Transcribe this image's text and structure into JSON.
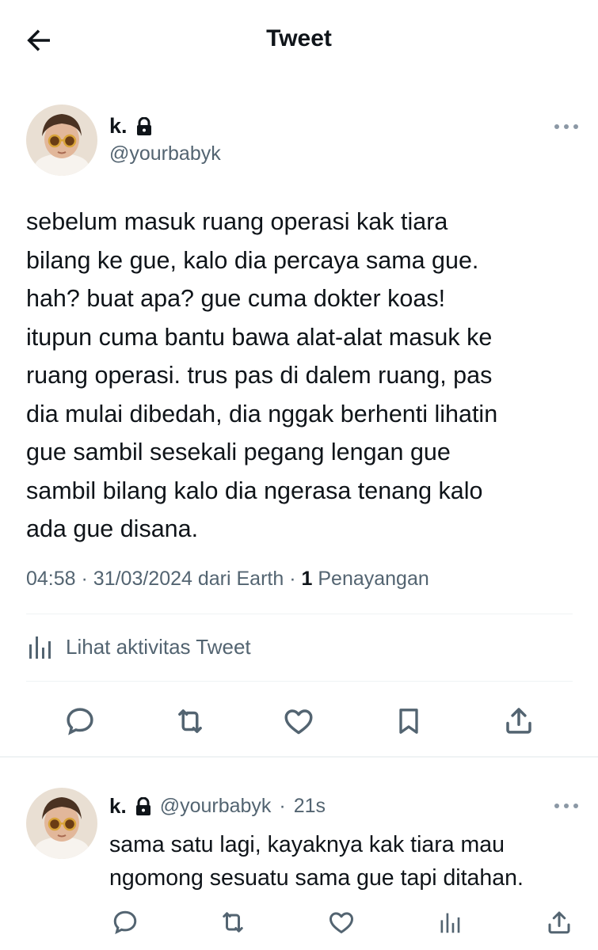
{
  "header": {
    "title": "Tweet"
  },
  "tweet": {
    "name": "k.",
    "handle": "@yourbabyk",
    "text": "sebelum masuk ruang operasi kak tiara\nbilang ke gue, kalo dia percaya sama gue.\nhah? buat apa? gue cuma dokter koas!\nitupun cuma bantu bawa alat-alat masuk ke\nruang operasi. trus pas di dalem ruang, pas\ndia mulai dibedah, dia nggak berhenti lihatin\ngue sambil sesekali pegang lengan gue\nsambil bilang kalo dia ngerasa tenang kalo\nada gue disana.",
    "time": "04:58",
    "date": "31/03/2024",
    "source": "dari Earth",
    "views_count": "1",
    "views_label": "Penayangan",
    "activity_label": "Lihat aktivitas Tweet"
  },
  "reply": {
    "name": "k.",
    "handle": "@yourbabyk",
    "age": "21s",
    "text": "sama satu lagi, kayaknya kak tiara mau\nngomong sesuatu sama gue tapi ditahan."
  },
  "icons": {
    "back": "arrow-left-icon",
    "lock": "lock-icon",
    "more": "more-horizontal-icon",
    "activity": "bar-chart-icon",
    "reply": "chat-bubble-icon",
    "retweet": "retweet-icon",
    "like": "heart-icon",
    "bookmark": "bookmark-icon",
    "share": "share-icon"
  },
  "colors": {
    "text": "#0f1419",
    "secondary": "#536471",
    "divider": "#eff3f4"
  }
}
